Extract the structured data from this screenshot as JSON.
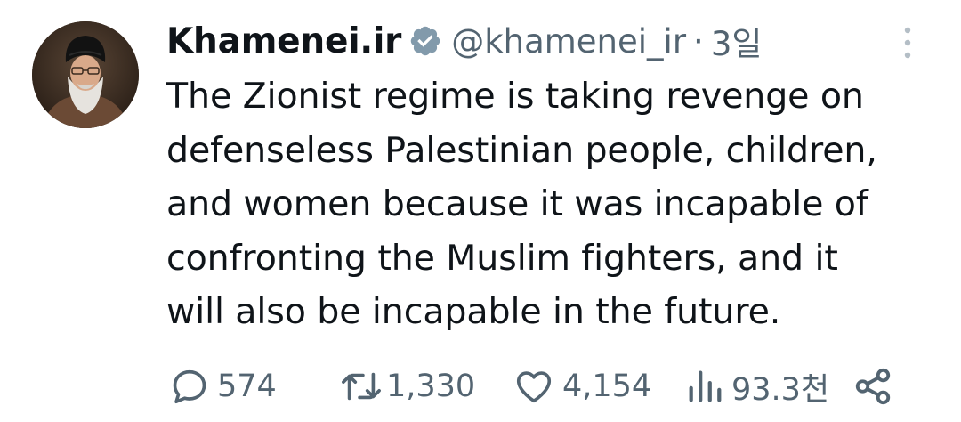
{
  "tweet": {
    "display_name": "Khamenei.ir",
    "handle": "@khamenei_ir",
    "separator": "·",
    "time": "3일",
    "text": "The Zionist regime is taking revenge on\ndefenseless Palestinian people, children,\nand women because it was incapable of\nconfronting the Muslim fighters, and it\nwill also be incapable in the future."
  },
  "actions": {
    "replies": "574",
    "reposts": "1,330",
    "likes": "4,154",
    "views": "93.3천"
  },
  "icons": {
    "verified": "verified-badge-icon",
    "more": "more-vertical-icon",
    "reply": "reply-bubble-icon",
    "repost": "repost-arrows-icon",
    "like": "heart-icon",
    "views": "views-bars-icon",
    "share": "share-nodes-icon"
  },
  "colors": {
    "text": "#0f1419",
    "secondary": "#536471",
    "verified_badge": "#829aab",
    "background": "#ffffff"
  }
}
